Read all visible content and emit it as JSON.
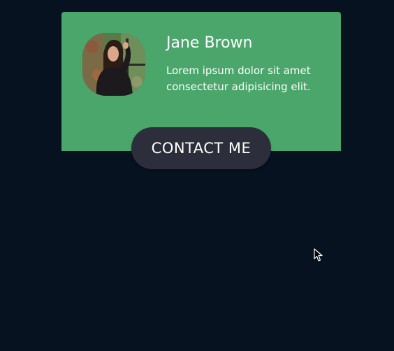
{
  "card": {
    "name": "Jane Brown",
    "bio": "Lorem ipsum dolor sit amet consectetur adipisicing elit.",
    "contact_label": "CONTACT ME",
    "avatar_icon": "profile-photo"
  },
  "colors": {
    "background": "#06121f",
    "card": "#4aa66a",
    "button": "#2c2f3b",
    "text": "#ffffff"
  },
  "cursor_icon": "arrow-cursor-icon"
}
